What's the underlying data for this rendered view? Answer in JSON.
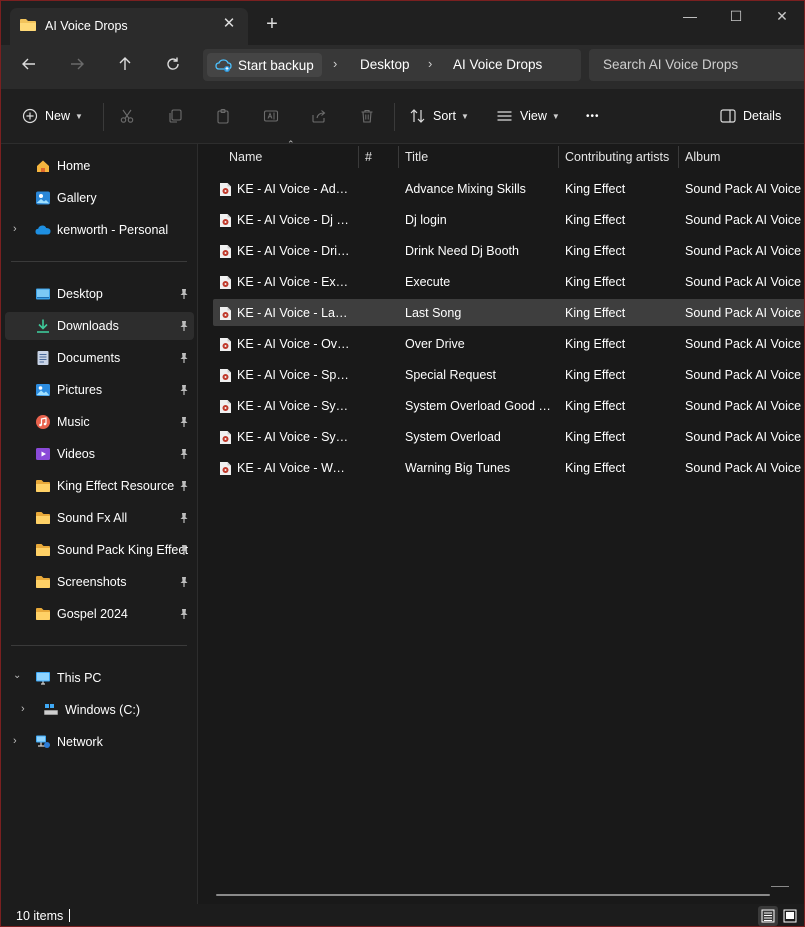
{
  "window": {
    "tab_title": "AI Voice Drops",
    "close_tab": "✕",
    "new_tab": "+",
    "minimize": "—",
    "maximize": "☐",
    "close": "✕"
  },
  "addressbar": {
    "backup_label": "Start backup",
    "crumbs": [
      "Desktop",
      "AI Voice Drops"
    ],
    "search_placeholder": "Search AI Voice Drops"
  },
  "commandbar": {
    "new_label": "New",
    "sort_label": "Sort",
    "view_label": "View",
    "more_label": "•••",
    "details_label": "Details"
  },
  "sidebar": {
    "home": "Home",
    "gallery": "Gallery",
    "onedrive": "kenworth - Personal",
    "quick": [
      {
        "label": "Desktop",
        "icon": "desktop-icon"
      },
      {
        "label": "Downloads",
        "icon": "downloads-icon"
      },
      {
        "label": "Documents",
        "icon": "documents-icon"
      },
      {
        "label": "Pictures",
        "icon": "pictures-icon"
      },
      {
        "label": "Music",
        "icon": "music-icon"
      },
      {
        "label": "Videos",
        "icon": "videos-icon"
      },
      {
        "label": "King Effect Resource",
        "icon": "folder-icon"
      },
      {
        "label": "Sound Fx All",
        "icon": "folder-icon"
      },
      {
        "label": "Sound Pack King Effect",
        "icon": "folder-icon"
      },
      {
        "label": "Screenshots",
        "icon": "folder-icon"
      },
      {
        "label": "Gospel 2024",
        "icon": "folder-icon"
      }
    ],
    "this_pc": "This PC",
    "windows_c": "Windows (C:)",
    "network": "Network"
  },
  "columns": {
    "name": "Name",
    "number": "#",
    "title": "Title",
    "artists": "Contributing artists",
    "album": "Album"
  },
  "files": [
    {
      "name": "KE - AI Voice - Advance Mixing Skills",
      "title": "Advance Mixing Skills",
      "artist": "King Effect",
      "album": "Sound Pack AI Voice"
    },
    {
      "name": "KE - AI Voice - Dj login",
      "title": "Dj login",
      "artist": "King Effect",
      "album": "Sound Pack AI Voice"
    },
    {
      "name": "KE - AI Voice - Drink Need Dj Booth",
      "title": "Drink Need Dj Booth",
      "artist": "King Effect",
      "album": "Sound Pack AI Voice"
    },
    {
      "name": "KE - AI Voice - Execute",
      "title": "Execute",
      "artist": "King Effect",
      "album": "Sound Pack AI Voice"
    },
    {
      "name": "KE - AI Voice - Last Song",
      "title": "Last Song",
      "artist": "King Effect",
      "album": "Sound Pack AI Voice"
    },
    {
      "name": "KE - AI Voice - Over Drive",
      "title": "Over Drive",
      "artist": "King Effect",
      "album": "Sound Pack AI Voice"
    },
    {
      "name": "KE - AI Voice - Special Request",
      "title": "Special Request",
      "artist": "King Effect",
      "album": "Sound Pack AI Voice"
    },
    {
      "name": "KE - AI Voice - System Overload Good Night",
      "title": "System Overload Good Night",
      "artist": "King Effect",
      "album": "Sound Pack AI Voice"
    },
    {
      "name": "KE - AI Voice - System Overload",
      "title": "System Overload",
      "artist": "King Effect",
      "album": "Sound Pack AI Voice"
    },
    {
      "name": "KE - AI Voice - Warning Big Tunes",
      "title": "Warning Big Tunes",
      "artist": "King Effect",
      "album": "Sound Pack AI Voice"
    }
  ],
  "selected_index": 4,
  "status": {
    "item_count": "10 items"
  },
  "colors": {
    "accent": "#4cc2ff",
    "folder": "#f2c35b",
    "selected_row": "#3e3e3e",
    "border": "#7a2020"
  }
}
